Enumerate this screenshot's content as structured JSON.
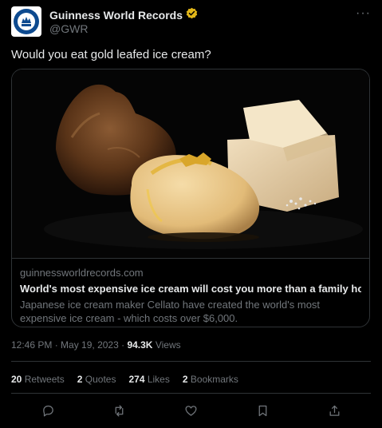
{
  "account": {
    "display_name": "Guinness World Records",
    "handle": "@GWR"
  },
  "tweet": {
    "text": "Would you eat gold leafed ice cream?"
  },
  "card": {
    "domain": "guinnessworldrecords.com",
    "title": "World's most expensive ice cream will cost you more than a family holiday w...",
    "description": "Japanese ice cream maker Cellato have created the world's most expensive ice cream - which costs over $6,000."
  },
  "meta": {
    "time": "12:46 PM",
    "date": "May 19, 2023",
    "views_count": "94.3K",
    "views_label": "Views"
  },
  "stats": {
    "retweets_count": "20",
    "retweets_label": "Retweets",
    "quotes_count": "2",
    "quotes_label": "Quotes",
    "likes_count": "274",
    "likes_label": "Likes",
    "bookmarks_count": "2",
    "bookmarks_label": "Bookmarks"
  },
  "colors": {
    "background": "#000000",
    "text": "#e7e9ea",
    "muted": "#71767b",
    "border": "#2f3336",
    "verified_gold": "#e2b719"
  },
  "icons": [
    "more-icon",
    "verified-badge-icon",
    "reply-icon",
    "retweet-icon",
    "like-icon",
    "bookmark-icon",
    "share-icon"
  ]
}
